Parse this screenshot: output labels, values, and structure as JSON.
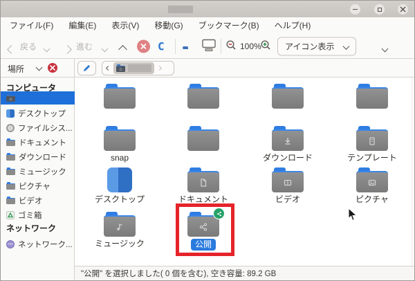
{
  "window": {
    "title": "",
    "controls": {
      "minimize": "minimize",
      "maximize": "maximize",
      "close": "close"
    }
  },
  "menubar": {
    "items": [
      "ファイル(F)",
      "編集(E)",
      "表示(V)",
      "移動(G)",
      "ブックマーク(B)",
      "ヘルプ(H)"
    ]
  },
  "toolbar": {
    "back_label": "戻る",
    "forward_label": "進む",
    "zoom_level": "100%",
    "view_mode": "アイコン表示"
  },
  "location_bar": {
    "places_label": "場所"
  },
  "sidebar": {
    "computer_header": "コンピュータ",
    "network_header": "ネットワーク",
    "items": [
      {
        "label": "",
        "icon": "home-folder",
        "selected": true
      },
      {
        "label": "デスクトップ",
        "icon": "desktop"
      },
      {
        "label": "ファイルシス...",
        "icon": "filesystem-disk"
      },
      {
        "label": "ドキュメント",
        "icon": "folder"
      },
      {
        "label": "ダウンロード",
        "icon": "folder"
      },
      {
        "label": "ミュージック",
        "icon": "folder"
      },
      {
        "label": "ピクチャ",
        "icon": "folder"
      },
      {
        "label": "ビデオ",
        "icon": "folder"
      },
      {
        "label": "ゴミ箱",
        "icon": "trash"
      }
    ],
    "network_items": [
      {
        "label": "ネットワーク...",
        "icon": "network"
      }
    ]
  },
  "folders": [
    {
      "label": ""
    },
    {
      "label": ""
    },
    {
      "label": ""
    },
    {
      "label": ""
    },
    {
      "label": "snap"
    },
    {
      "label": ""
    },
    {
      "label": "ダウンロード"
    },
    {
      "label": "テンプレート"
    },
    {
      "label": "デスクトップ"
    },
    {
      "label": "ドキュメント"
    },
    {
      "label": "ビデオ"
    },
    {
      "label": "ピクチャ"
    },
    {
      "label": "ミュージック"
    },
    {
      "label": "公開",
      "selected": true,
      "shared": true
    }
  ],
  "statusbar": {
    "text": "\"公開\" を選択しました( 0 個を含む), 空き容量: 89.2 GB"
  },
  "colors": {
    "selection_blue": "#1e6fd9",
    "folder_tab_blue": "#2f7de2",
    "share_badge_green": "#26a269",
    "annotation_red": "#e5242a",
    "stop_red": "#df8184",
    "titlebar_gray": "#ccc8c4"
  }
}
